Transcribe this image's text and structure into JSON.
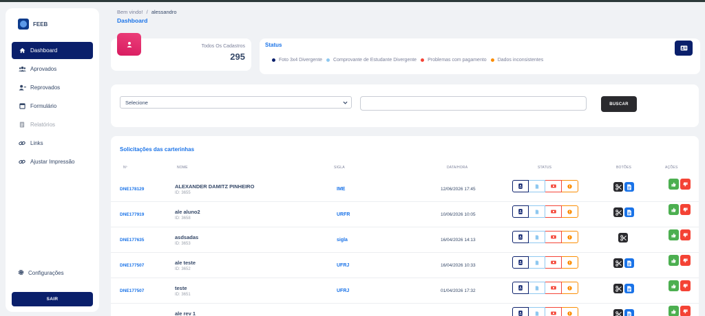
{
  "brand": {
    "name": "FEEB"
  },
  "sidebar": {
    "items": [
      {
        "label": "Dashboard",
        "icon": "home-icon"
      },
      {
        "label": "Aprovados",
        "icon": "users-icon"
      },
      {
        "label": "Reprovados",
        "icon": "user-minus-icon"
      },
      {
        "label": "Formulário",
        "icon": "form-icon"
      },
      {
        "label": "Relatórios",
        "icon": "report-icon"
      },
      {
        "label": "Links",
        "icon": "link-icon"
      },
      {
        "label": "Ajustar Impressão",
        "icon": "link-icon"
      }
    ],
    "settings_label": "Configurações",
    "logout_label": "SAIR"
  },
  "breadcrumb": {
    "welcome": "Bem vindo!",
    "separator": "/",
    "user": "alessandro"
  },
  "page_title": "Dashboard",
  "stats": {
    "label": "Todos Os Cadastros",
    "value": "295"
  },
  "status": {
    "title": "Status",
    "legend": [
      {
        "label": "Foto 3x4 Divergente",
        "color": "#0a1f6b"
      },
      {
        "label": "Comprovante de Estudante Divergente",
        "color": "#8ec8f0"
      },
      {
        "label": "Problemas com pagamento",
        "color": "#f44335"
      },
      {
        "label": "Dados inconsistentes",
        "color": "#fb8c00"
      }
    ]
  },
  "filter": {
    "select_value": "Selecione",
    "input_value": "",
    "search_label": "BUSCAR"
  },
  "table": {
    "title": "Solicitações das carterinhas",
    "headers": {
      "num": "Nº",
      "name": "NOME",
      "sigla": "SIGLA",
      "date": "DATA/HORA",
      "status": "STATUS",
      "botoes": "BOTÕES",
      "acoes": "AÇÕES"
    },
    "rows": [
      {
        "num": "DNE178129",
        "name": "ALEXANDER DAMITZ PINHEIRO",
        "id": "ID: 3655",
        "sigla": "IME",
        "date": "12/06/2026 17:45"
      },
      {
        "num": "DNE177919",
        "name": "ale aluno2",
        "id": "ID: 3658",
        "sigla": "URFR",
        "date": "10/06/2026 10:05"
      },
      {
        "num": "DNE177635",
        "name": "asdsadas",
        "id": "ID: 3653",
        "sigla": "sigla",
        "date": "16/04/2026 14:13"
      },
      {
        "num": "DNE177507",
        "name": "ale teste",
        "id": "ID: 3652",
        "sigla": "UFRJ",
        "date": "16/04/2026 10:33"
      },
      {
        "num": "DNE177507",
        "name": "teste",
        "id": "ID: 3651",
        "sigla": "UFRJ",
        "date": "01/04/2026 17:32"
      },
      {
        "num": "",
        "name": "ale rev 1",
        "id": "",
        "sigla": "",
        "date": ""
      }
    ]
  }
}
